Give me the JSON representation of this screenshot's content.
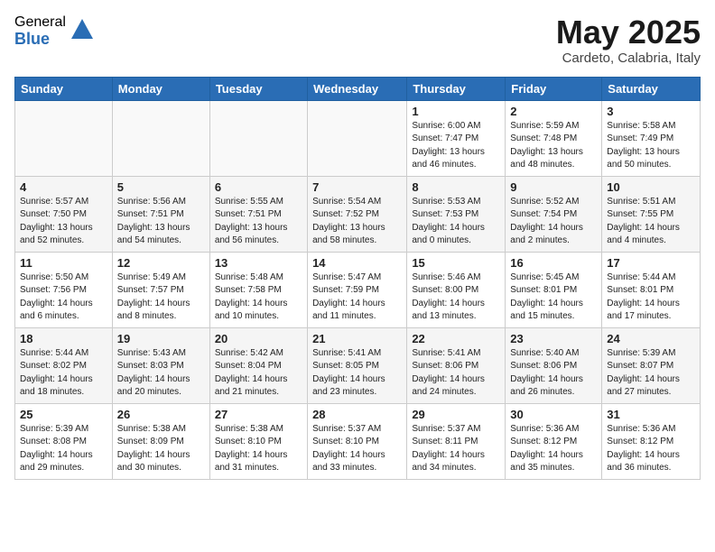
{
  "header": {
    "logo_general": "General",
    "logo_blue": "Blue",
    "month_title": "May 2025",
    "location": "Cardeto, Calabria, Italy"
  },
  "weekdays": [
    "Sunday",
    "Monday",
    "Tuesday",
    "Wednesday",
    "Thursday",
    "Friday",
    "Saturday"
  ],
  "weeks": [
    [
      {
        "num": "",
        "lines": []
      },
      {
        "num": "",
        "lines": []
      },
      {
        "num": "",
        "lines": []
      },
      {
        "num": "",
        "lines": []
      },
      {
        "num": "1",
        "lines": [
          "Sunrise: 6:00 AM",
          "Sunset: 7:47 PM",
          "Daylight: 13 hours",
          "and 46 minutes."
        ]
      },
      {
        "num": "2",
        "lines": [
          "Sunrise: 5:59 AM",
          "Sunset: 7:48 PM",
          "Daylight: 13 hours",
          "and 48 minutes."
        ]
      },
      {
        "num": "3",
        "lines": [
          "Sunrise: 5:58 AM",
          "Sunset: 7:49 PM",
          "Daylight: 13 hours",
          "and 50 minutes."
        ]
      }
    ],
    [
      {
        "num": "4",
        "lines": [
          "Sunrise: 5:57 AM",
          "Sunset: 7:50 PM",
          "Daylight: 13 hours",
          "and 52 minutes."
        ]
      },
      {
        "num": "5",
        "lines": [
          "Sunrise: 5:56 AM",
          "Sunset: 7:51 PM",
          "Daylight: 13 hours",
          "and 54 minutes."
        ]
      },
      {
        "num": "6",
        "lines": [
          "Sunrise: 5:55 AM",
          "Sunset: 7:51 PM",
          "Daylight: 13 hours",
          "and 56 minutes."
        ]
      },
      {
        "num": "7",
        "lines": [
          "Sunrise: 5:54 AM",
          "Sunset: 7:52 PM",
          "Daylight: 13 hours",
          "and 58 minutes."
        ]
      },
      {
        "num": "8",
        "lines": [
          "Sunrise: 5:53 AM",
          "Sunset: 7:53 PM",
          "Daylight: 14 hours",
          "and 0 minutes."
        ]
      },
      {
        "num": "9",
        "lines": [
          "Sunrise: 5:52 AM",
          "Sunset: 7:54 PM",
          "Daylight: 14 hours",
          "and 2 minutes."
        ]
      },
      {
        "num": "10",
        "lines": [
          "Sunrise: 5:51 AM",
          "Sunset: 7:55 PM",
          "Daylight: 14 hours",
          "and 4 minutes."
        ]
      }
    ],
    [
      {
        "num": "11",
        "lines": [
          "Sunrise: 5:50 AM",
          "Sunset: 7:56 PM",
          "Daylight: 14 hours",
          "and 6 minutes."
        ]
      },
      {
        "num": "12",
        "lines": [
          "Sunrise: 5:49 AM",
          "Sunset: 7:57 PM",
          "Daylight: 14 hours",
          "and 8 minutes."
        ]
      },
      {
        "num": "13",
        "lines": [
          "Sunrise: 5:48 AM",
          "Sunset: 7:58 PM",
          "Daylight: 14 hours",
          "and 10 minutes."
        ]
      },
      {
        "num": "14",
        "lines": [
          "Sunrise: 5:47 AM",
          "Sunset: 7:59 PM",
          "Daylight: 14 hours",
          "and 11 minutes."
        ]
      },
      {
        "num": "15",
        "lines": [
          "Sunrise: 5:46 AM",
          "Sunset: 8:00 PM",
          "Daylight: 14 hours",
          "and 13 minutes."
        ]
      },
      {
        "num": "16",
        "lines": [
          "Sunrise: 5:45 AM",
          "Sunset: 8:01 PM",
          "Daylight: 14 hours",
          "and 15 minutes."
        ]
      },
      {
        "num": "17",
        "lines": [
          "Sunrise: 5:44 AM",
          "Sunset: 8:01 PM",
          "Daylight: 14 hours",
          "and 17 minutes."
        ]
      }
    ],
    [
      {
        "num": "18",
        "lines": [
          "Sunrise: 5:44 AM",
          "Sunset: 8:02 PM",
          "Daylight: 14 hours",
          "and 18 minutes."
        ]
      },
      {
        "num": "19",
        "lines": [
          "Sunrise: 5:43 AM",
          "Sunset: 8:03 PM",
          "Daylight: 14 hours",
          "and 20 minutes."
        ]
      },
      {
        "num": "20",
        "lines": [
          "Sunrise: 5:42 AM",
          "Sunset: 8:04 PM",
          "Daylight: 14 hours",
          "and 21 minutes."
        ]
      },
      {
        "num": "21",
        "lines": [
          "Sunrise: 5:41 AM",
          "Sunset: 8:05 PM",
          "Daylight: 14 hours",
          "and 23 minutes."
        ]
      },
      {
        "num": "22",
        "lines": [
          "Sunrise: 5:41 AM",
          "Sunset: 8:06 PM",
          "Daylight: 14 hours",
          "and 24 minutes."
        ]
      },
      {
        "num": "23",
        "lines": [
          "Sunrise: 5:40 AM",
          "Sunset: 8:06 PM",
          "Daylight: 14 hours",
          "and 26 minutes."
        ]
      },
      {
        "num": "24",
        "lines": [
          "Sunrise: 5:39 AM",
          "Sunset: 8:07 PM",
          "Daylight: 14 hours",
          "and 27 minutes."
        ]
      }
    ],
    [
      {
        "num": "25",
        "lines": [
          "Sunrise: 5:39 AM",
          "Sunset: 8:08 PM",
          "Daylight: 14 hours",
          "and 29 minutes."
        ]
      },
      {
        "num": "26",
        "lines": [
          "Sunrise: 5:38 AM",
          "Sunset: 8:09 PM",
          "Daylight: 14 hours",
          "and 30 minutes."
        ]
      },
      {
        "num": "27",
        "lines": [
          "Sunrise: 5:38 AM",
          "Sunset: 8:10 PM",
          "Daylight: 14 hours",
          "and 31 minutes."
        ]
      },
      {
        "num": "28",
        "lines": [
          "Sunrise: 5:37 AM",
          "Sunset: 8:10 PM",
          "Daylight: 14 hours",
          "and 33 minutes."
        ]
      },
      {
        "num": "29",
        "lines": [
          "Sunrise: 5:37 AM",
          "Sunset: 8:11 PM",
          "Daylight: 14 hours",
          "and 34 minutes."
        ]
      },
      {
        "num": "30",
        "lines": [
          "Sunrise: 5:36 AM",
          "Sunset: 8:12 PM",
          "Daylight: 14 hours",
          "and 35 minutes."
        ]
      },
      {
        "num": "31",
        "lines": [
          "Sunrise: 5:36 AM",
          "Sunset: 8:12 PM",
          "Daylight: 14 hours",
          "and 36 minutes."
        ]
      }
    ]
  ]
}
